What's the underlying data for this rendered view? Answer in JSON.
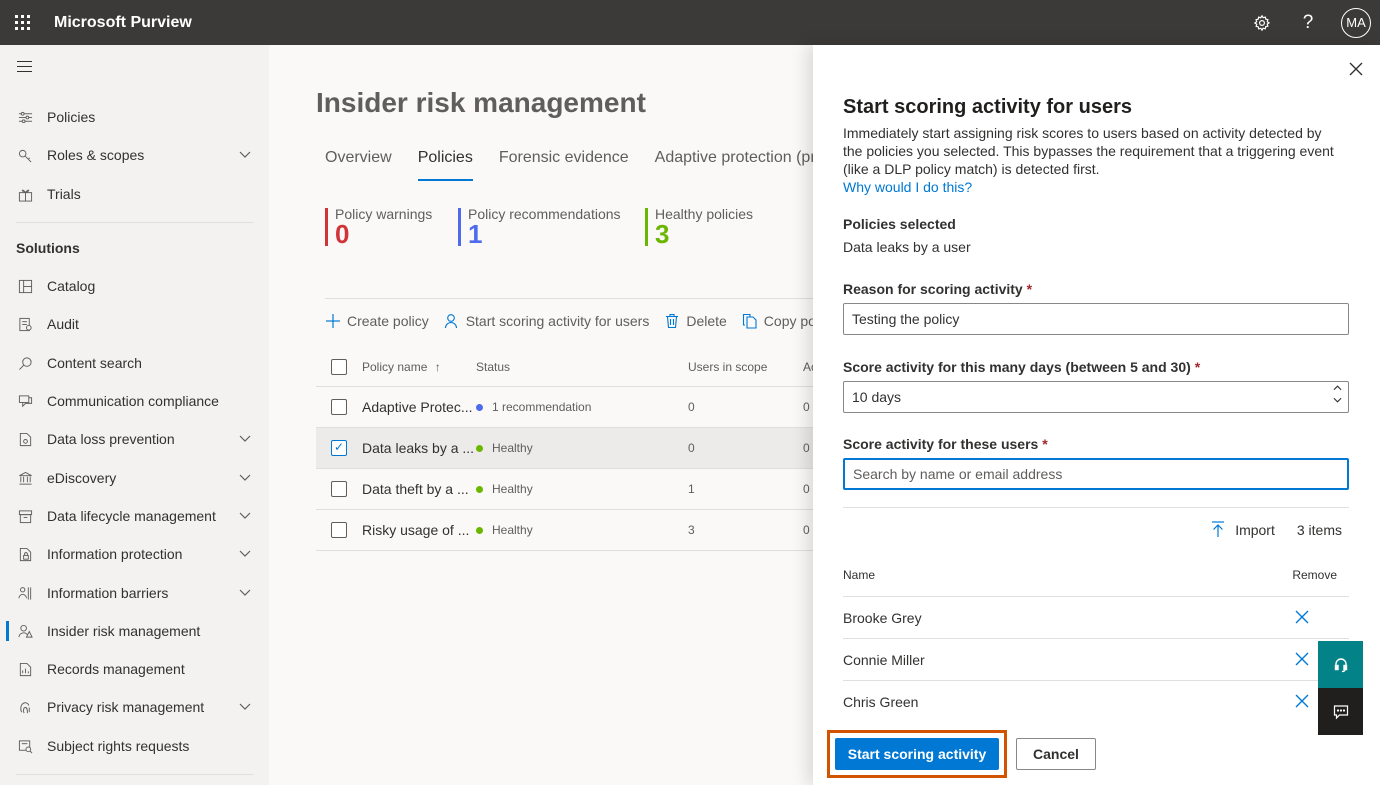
{
  "topbar": {
    "app_title": "Microsoft Purview",
    "avatar_initials": "MA",
    "help_glyph": "?"
  },
  "sidebar": {
    "items_top": [
      {
        "label": "Policies",
        "icon": "policies-icon"
      },
      {
        "label": "Roles & scopes",
        "icon": "key-icon",
        "expandable": true
      },
      {
        "label": "Trials",
        "icon": "trials-icon"
      }
    ],
    "section_label": "Solutions",
    "items": [
      {
        "label": "Catalog",
        "icon": "catalog-icon"
      },
      {
        "label": "Audit",
        "icon": "audit-icon"
      },
      {
        "label": "Content search",
        "icon": "search-icon"
      },
      {
        "label": "Communication compliance",
        "icon": "chat-icon"
      },
      {
        "label": "Data loss prevention",
        "icon": "dlp-icon",
        "expandable": true
      },
      {
        "label": "eDiscovery",
        "icon": "ediscovery-icon",
        "expandable": true
      },
      {
        "label": "Data lifecycle management",
        "icon": "archive-icon",
        "expandable": true
      },
      {
        "label": "Information protection",
        "icon": "lock-icon",
        "expandable": true
      },
      {
        "label": "Information barriers",
        "icon": "barrier-icon",
        "expandable": true
      },
      {
        "label": "Insider risk management",
        "icon": "insider-icon",
        "active": true
      },
      {
        "label": "Records management",
        "icon": "records-icon"
      },
      {
        "label": "Privacy risk management",
        "icon": "fingerprint-icon",
        "expandable": true
      },
      {
        "label": "Subject rights requests",
        "icon": "requests-icon"
      }
    ]
  },
  "main": {
    "title": "Insider risk management",
    "tabs": [
      {
        "label": "Overview"
      },
      {
        "label": "Policies",
        "selected": true
      },
      {
        "label": "Forensic evidence"
      },
      {
        "label": "Adaptive protection (previ"
      }
    ],
    "stats": [
      {
        "label": "Policy warnings",
        "value": "0",
        "color": "#d13438"
      },
      {
        "label": "Policy recommendations",
        "value": "1",
        "color": "#4f6bed"
      },
      {
        "label": "Healthy policies",
        "value": "3",
        "color": "#6bb700"
      }
    ],
    "toolbar": {
      "create": "Create policy",
      "start_scoring": "Start scoring activity for users",
      "delete": "Delete",
      "copy": "Copy pol"
    },
    "table": {
      "headers": {
        "name": "Policy name",
        "status": "Status",
        "users": "Users in scope",
        "ac": "Ac"
      },
      "rows": [
        {
          "name": "Adaptive Protec...",
          "status": "1 recommendation",
          "status_color": "#4f6bed",
          "users": "0",
          "ac": "0",
          "checked": false
        },
        {
          "name": "Data leaks by a ...",
          "status": "Healthy",
          "status_color": "#6bb700",
          "users": "0",
          "ac": "0",
          "checked": true
        },
        {
          "name": "Data theft by a ...",
          "status": "Healthy",
          "status_color": "#6bb700",
          "users": "1",
          "ac": "0",
          "checked": false
        },
        {
          "name": "Risky usage of ...",
          "status": "Healthy",
          "status_color": "#6bb700",
          "users": "3",
          "ac": "0",
          "checked": false
        }
      ]
    }
  },
  "panel": {
    "title": "Start scoring activity for users",
    "description": "Immediately start assigning risk scores to users based on activity detected by the policies you selected. This bypasses the requirement that a triggering event (like a DLP policy match) is detected first.",
    "link": "Why would I do this?",
    "policies_label": "Policies selected",
    "policies_value": "Data leaks by a user",
    "reason_label": "Reason for scoring activity",
    "reason_value": "Testing the policy",
    "days_label": "Score activity for this many days (between 5 and 30)",
    "days_value": "10 days",
    "users_label": "Score activity for these users",
    "users_placeholder": "Search by name or email address",
    "required_mark": "*",
    "import_label": "Import",
    "items_count": "3 items",
    "list_headers": {
      "name": "Name",
      "remove": "Remove"
    },
    "users": [
      {
        "name": "Brooke Grey"
      },
      {
        "name": "Connie Miller"
      },
      {
        "name": "Chris Green"
      }
    ],
    "primary_button": "Start scoring activity",
    "cancel_button": "Cancel",
    "accent_color": "#0078d4",
    "highlight_color": "#d35400"
  }
}
